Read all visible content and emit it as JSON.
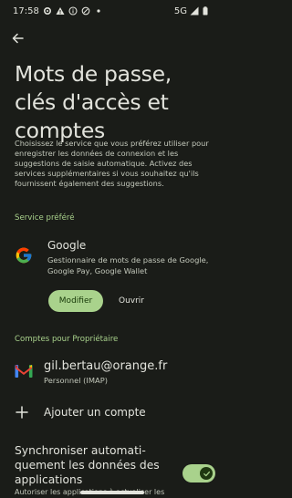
{
  "status_bar": {
    "time": "17:58",
    "network": "5G",
    "left_icons": [
      "settings-gear-icon",
      "warning-icon",
      "info-icon",
      "data-saver-icon",
      "dot-icon"
    ],
    "right_icons": [
      "signal-icon",
      "battery-icon"
    ]
  },
  "header": {
    "back_icon": "arrow-back-icon",
    "title": "Mots de passe, clés d'accès et comptes"
  },
  "description": "Choisissez le service que vous préférez utiliser pour enregistrer les données de connexion et les suggestions de saisie automatique. Activez des services supplémentaires si vous souhaitez qu'ils fournissent également des suggestions.",
  "preferred_service": {
    "section_label": "Service préféré",
    "provider_name": "Google",
    "provider_desc": "Gestionnaire de mots de passe de Google, Google Pay, Google Wallet",
    "modify_label": "Modifier",
    "open_label": "Ouvrir"
  },
  "accounts": {
    "section_label": "Comptes pour Propriétaire",
    "items": [
      {
        "email": "gil.bertau@orange.fr",
        "type": "Personnel (IMAP)",
        "icon": "gmail-icon"
      }
    ],
    "add_label": "Ajouter un compte"
  },
  "sync": {
    "title": "Synchroniser automati-quement les données des applications",
    "subtitle": "Autoriser les applications à actualiser les",
    "enabled": true
  },
  "colors": {
    "background": "#1a1c18",
    "accent": "#a9d28c",
    "on_accent": "#163807",
    "text_primary": "#e2e3dc",
    "text_secondary": "#c3c8bb"
  }
}
